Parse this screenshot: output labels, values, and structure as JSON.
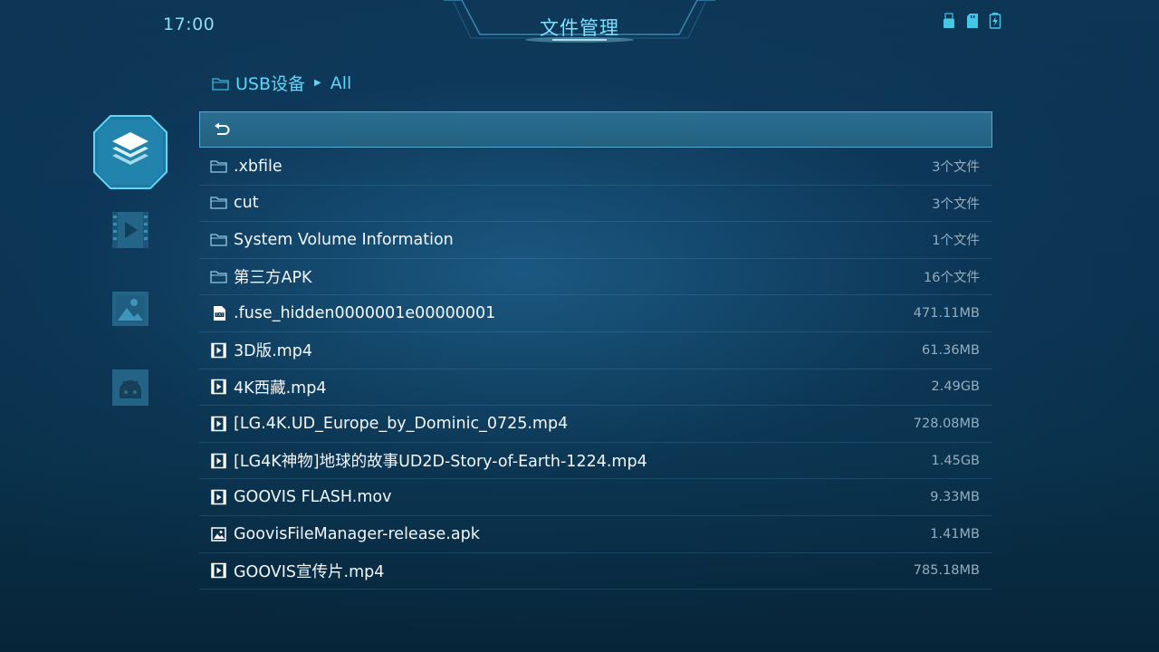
{
  "status_bar": {
    "time": "17:00",
    "title": "文件管理",
    "icons": [
      "usb-drive-icon",
      "sd-card-icon",
      "battery-charging-icon"
    ]
  },
  "breadcrumb": {
    "root": "USB设备",
    "current": "All"
  },
  "sidebar": {
    "items": [
      {
        "name": "all-files",
        "icon": "layers-icon",
        "active": true
      },
      {
        "name": "videos",
        "icon": "film-play-icon",
        "active": false
      },
      {
        "name": "images",
        "icon": "picture-icon",
        "active": false
      },
      {
        "name": "apps",
        "icon": "android-icon",
        "active": false
      }
    ]
  },
  "file_list": {
    "back_icon": "return-arrow-icon",
    "items": [
      {
        "name": ".xbfile",
        "meta": "3个文件",
        "type": "folder"
      },
      {
        "name": "cut",
        "meta": "3个文件",
        "type": "folder"
      },
      {
        "name": "System Volume Information",
        "meta": "1个文件",
        "type": "folder"
      },
      {
        "name": "第三方APK",
        "meta": "16个文件",
        "type": "folder"
      },
      {
        "name": ".fuse_hidden0000001e00000001",
        "meta": "471.11MB",
        "type": "txt"
      },
      {
        "name": "3D版.mp4",
        "meta": "61.36MB",
        "type": "video"
      },
      {
        "name": "4K西藏.mp4",
        "meta": "2.49GB",
        "type": "video"
      },
      {
        "name": "[LG.4K.UD_Europe_by_Dominic_0725.mp4",
        "meta": "728.08MB",
        "type": "video"
      },
      {
        "name": "[LG4K神物]地球的故事UD2D-Story-of-Earth-1224.mp4",
        "meta": "1.45GB",
        "type": "video"
      },
      {
        "name": "GOOVIS FLASH.mov",
        "meta": "9.33MB",
        "type": "video"
      },
      {
        "name": "GoovisFileManager-release.apk",
        "meta": "1.41MB",
        "type": "image"
      },
      {
        "name": "GOOVIS宣传片.mp4",
        "meta": "785.18MB",
        "type": "video"
      }
    ]
  },
  "colors": {
    "accent": "#5fd6f8",
    "selected_row": "#2a6e92",
    "meta_text": "#94aebf"
  }
}
